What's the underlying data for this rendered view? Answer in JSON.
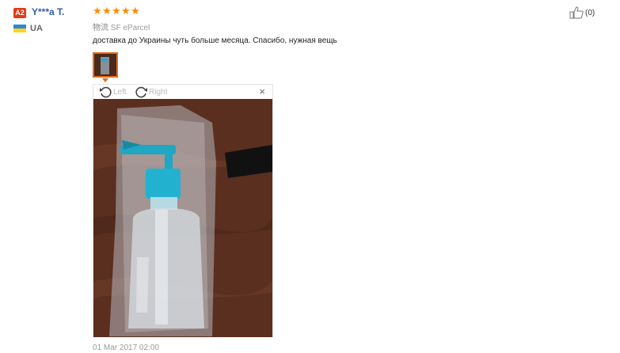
{
  "reviewer": {
    "level_badge": "A2",
    "name": "Y***a T.",
    "country": "UA",
    "flag_colors": [
      "#2e86d6",
      "#ffd21f"
    ]
  },
  "review": {
    "rating": 5,
    "stars": [
      "★",
      "★",
      "★",
      "★",
      "★"
    ],
    "star_color": "#ff8a00",
    "shipping_label": "物流",
    "shipping_method": "SF eParcel",
    "text": "доставка до Украины чуть больше месяца. Спасибо, нужная вещь",
    "date": "01 Mar 2017 02:00"
  },
  "helpful": {
    "count": "(0)",
    "icon": "thumbs-up-icon"
  },
  "viewer": {
    "rotate_left_label": "Left",
    "rotate_right_label": "Right",
    "close_glyph": "×"
  },
  "colors": {
    "accent": "#e86b1e",
    "link": "#2f5ea8",
    "badge": "#e33a16"
  }
}
